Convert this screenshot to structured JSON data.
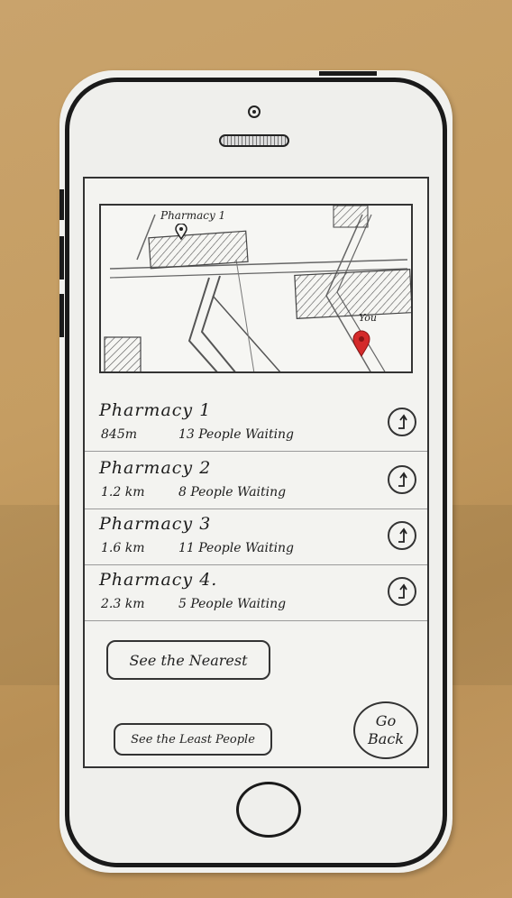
{
  "map": {
    "pin_label_pharmacy": "Pharmacy 1",
    "pin_label_you": "You",
    "user_pin_color": "#d42a2a"
  },
  "pharmacies": [
    {
      "name": "Pharmacy 1",
      "distance": "845m",
      "waiting": "13 People Waiting"
    },
    {
      "name": "Pharmacy 2",
      "distance": "1.2 km",
      "waiting": "8 People Waiting"
    },
    {
      "name": "Pharmacy 3",
      "distance": "1.6 km",
      "waiting": "11 People Waiting"
    },
    {
      "name": "Pharmacy 4.",
      "distance": "2.3 km",
      "waiting": "5 People Waiting"
    }
  ],
  "actions": {
    "see_nearest": "See the Nearest",
    "see_least_people": "See the Least People",
    "go_back_line1": "Go",
    "go_back_line2": "Back"
  },
  "icons": {
    "navigate": "navigate-arrow-icon",
    "map_pin": "map-pin-icon"
  }
}
